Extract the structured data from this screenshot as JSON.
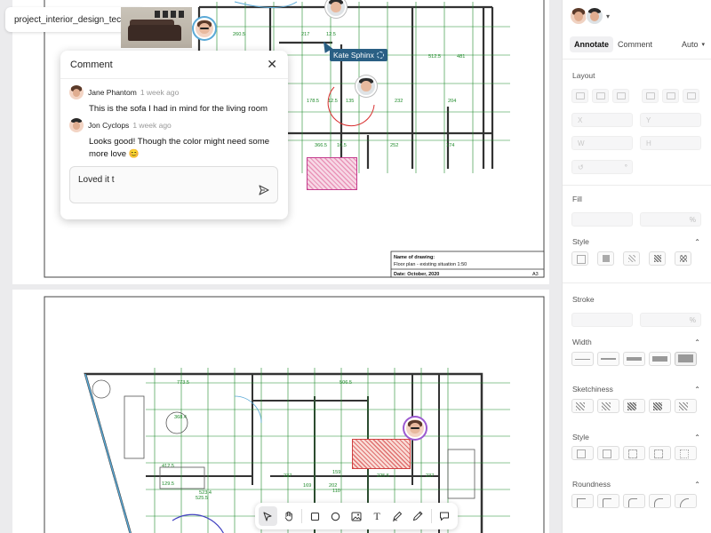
{
  "file": {
    "name": "project_interior_design_tech..."
  },
  "comment": {
    "title": "Comment",
    "entries": [
      {
        "author": "Jane Phantom",
        "time": "1 week ago",
        "text": "This is the sofa I had in mind for the living room"
      },
      {
        "author": "Jon Cyclops",
        "time": "1 week ago",
        "text": "Looks good! Though the color might need some more love 😊"
      }
    ],
    "reply_value": "Loved it t"
  },
  "cursor": {
    "user": "Kate Sphinx"
  },
  "drawing": {
    "title_label": "Name of drawing:",
    "title_value": "Floor plan - existing situation 1:50",
    "date": "Date: October, 2020",
    "sheet": "A3",
    "top_dims": [
      "260.5",
      "217",
      "12.5",
      "178.5",
      "12.5",
      "135",
      "232",
      "204",
      "366.5",
      "10.5",
      "252",
      "174",
      "25",
      "512.5",
      "481"
    ],
    "bottom_dims": [
      "773.5",
      "506.5",
      "368.4",
      "525.5",
      "237",
      "169",
      "202",
      "225.5",
      "237",
      "159",
      "110",
      "523.4",
      "412.5",
      "129.5"
    ]
  },
  "toolbar": {
    "tools": [
      "select",
      "hand",
      "rectangle",
      "ellipse",
      "image",
      "text",
      "pen",
      "pencil",
      "comment"
    ],
    "text_glyph": "T"
  },
  "panel": {
    "tabs": {
      "annotate": "Annotate",
      "comment": "Comment",
      "auto": "Auto"
    },
    "layout": {
      "title": "Layout",
      "x": "X",
      "y": "Y",
      "w": "W",
      "h": "H"
    },
    "fill": {
      "title": "Fill",
      "percent": "%",
      "style_title": "Style"
    },
    "stroke": {
      "title": "Stroke",
      "percent": "%",
      "width_title": "Width"
    },
    "sketchiness": {
      "title": "Sketchiness"
    },
    "style": {
      "title": "Style"
    },
    "roundness": {
      "title": "Roundness"
    }
  },
  "colors": {
    "accent": "#9b59d0",
    "label": "#2a5f84",
    "hatch": "#c33b8d",
    "dim": "#1e8a2a",
    "blue": "#5aa9d6"
  }
}
